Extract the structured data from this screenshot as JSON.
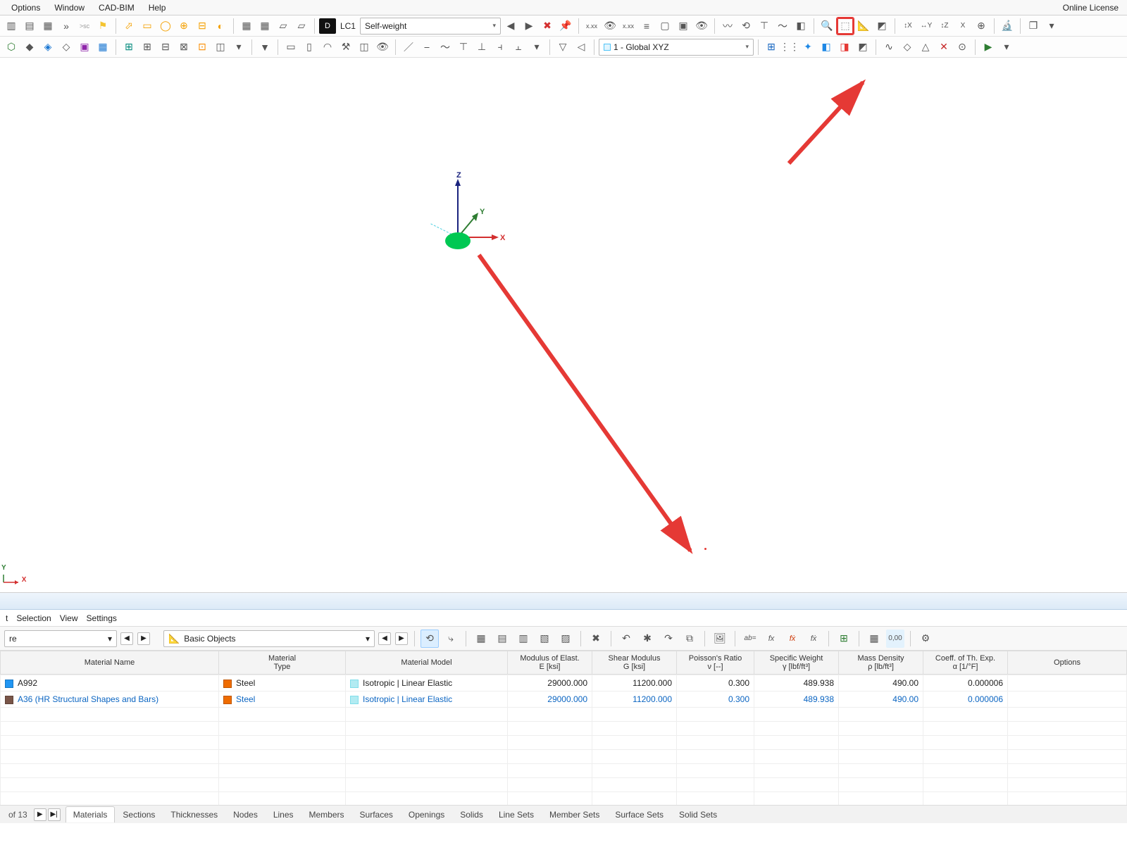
{
  "menu": {
    "options": "Options",
    "window": "Window",
    "cadbim": "CAD-BIM",
    "help": "Help",
    "license": "Online License"
  },
  "tb1": {
    "lc_badge": "D",
    "lc_label": "LC1",
    "lc_dropdown": "Self-weight"
  },
  "tb2": {
    "coord_sys": "1 - Global XYZ"
  },
  "panel_menu": {
    "t": "t",
    "selection": "Selection",
    "view": "View",
    "settings": "Settings"
  },
  "panel_tb": {
    "dd1": "re",
    "dd2": "Basic Objects"
  },
  "table": {
    "headers": {
      "name": "Material Name",
      "type": "Material\nType",
      "model": "Material Model",
      "E": "Modulus of Elast.\nE [ksi]",
      "G": "Shear Modulus\nG [ksi]",
      "nu": "Poisson's Ratio\nν [--]",
      "gamma": "Specific Weight\nγ [lbf/ft³]",
      "rho": "Mass Density\nρ [lb/ft³]",
      "alpha": "Coeff. of Th. Exp.\nα [1/°F]",
      "options": "Options"
    },
    "rows": [
      {
        "name": "A992",
        "type": "Steel",
        "model": "Isotropic | Linear Elastic",
        "E": "29000.000",
        "G": "11200.000",
        "nu": "0.300",
        "gamma": "489.938",
        "rho": "490.00",
        "alpha": "0.000006"
      },
      {
        "name": "A36 (HR Structural Shapes and Bars)",
        "type": "Steel",
        "model": "Isotropic | Linear Elastic",
        "E": "29000.000",
        "G": "11200.000",
        "nu": "0.300",
        "gamma": "489.938",
        "rho": "490.00",
        "alpha": "0.000006"
      }
    ]
  },
  "tabs": {
    "status": "of 13",
    "list": [
      "Materials",
      "Sections",
      "Thicknesses",
      "Nodes",
      "Lines",
      "Members",
      "Surfaces",
      "Openings",
      "Solids",
      "Line Sets",
      "Member Sets",
      "Surface Sets",
      "Solid Sets"
    ],
    "active": 0
  },
  "axes": {
    "x": "X",
    "y": "Y",
    "z": "Z"
  },
  "corner": {
    "x": "X",
    "y": "Y"
  }
}
